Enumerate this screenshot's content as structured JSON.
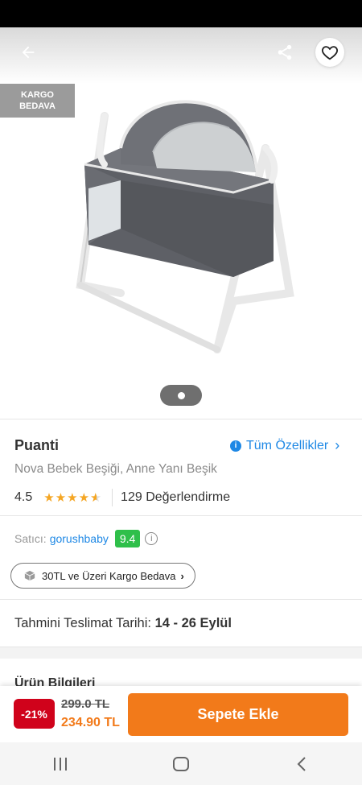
{
  "header": {
    "back_icon": "arrow-left-icon",
    "share_icon": "share-icon",
    "favorite_icon": "heart-outline-icon"
  },
  "badge": {
    "line1": "KARGO",
    "line2": "BEDAVA"
  },
  "product": {
    "brand": "Puanti",
    "name": "Nova Bebek Beşiği, Anne Yanı Beşik",
    "all_features_label": "Tüm Özellikler",
    "rating": "4.5",
    "rating_stars": 4.5,
    "review_count_label": "129 Değerlendirme"
  },
  "seller": {
    "label": "Satıcı:",
    "name": "gorushbaby",
    "score": "9.4"
  },
  "cargo_pill": {
    "label": "30TL ve Üzeri Kargo Bedava"
  },
  "delivery": {
    "label": "Tahmini Teslimat Tarihi:",
    "value": "14 - 26 Eylül"
  },
  "next_section": {
    "label": "Ürün Bilgileri"
  },
  "price": {
    "discount": "-21%",
    "old": "299.0 TL",
    "new": "234.90 TL"
  },
  "cart_button": "Sepete Ekle",
  "colors": {
    "accent": "#f27a1a",
    "link": "#1e88e5",
    "discount": "#d0021b",
    "score": "#2fbf4a"
  }
}
